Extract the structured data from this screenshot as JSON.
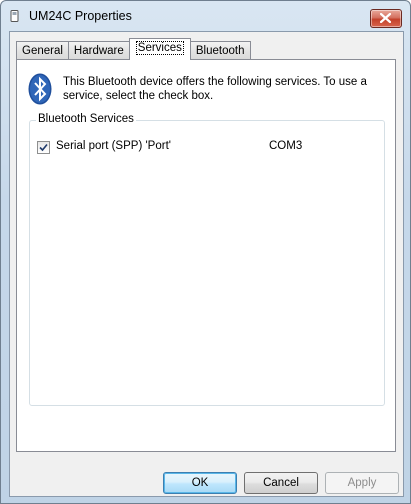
{
  "window": {
    "title": "UM24C Properties",
    "close_icon": "close-icon"
  },
  "tabs": [
    {
      "label": "General",
      "active": false
    },
    {
      "label": "Hardware",
      "active": false
    },
    {
      "label": "Services",
      "active": true
    },
    {
      "label": "Bluetooth",
      "active": false
    }
  ],
  "services_page": {
    "icon": "bluetooth-icon",
    "description": "This Bluetooth device offers the following services. To use a service, select the check box.",
    "group_label": "Bluetooth Services",
    "services": [
      {
        "name": "Serial port (SPP) 'Port'",
        "port": "COM3",
        "checked": true
      }
    ]
  },
  "buttons": {
    "ok": "OK",
    "cancel": "Cancel",
    "apply": "Apply"
  },
  "colors": {
    "accent": "#2f5ea8",
    "close": "#c3412a"
  }
}
